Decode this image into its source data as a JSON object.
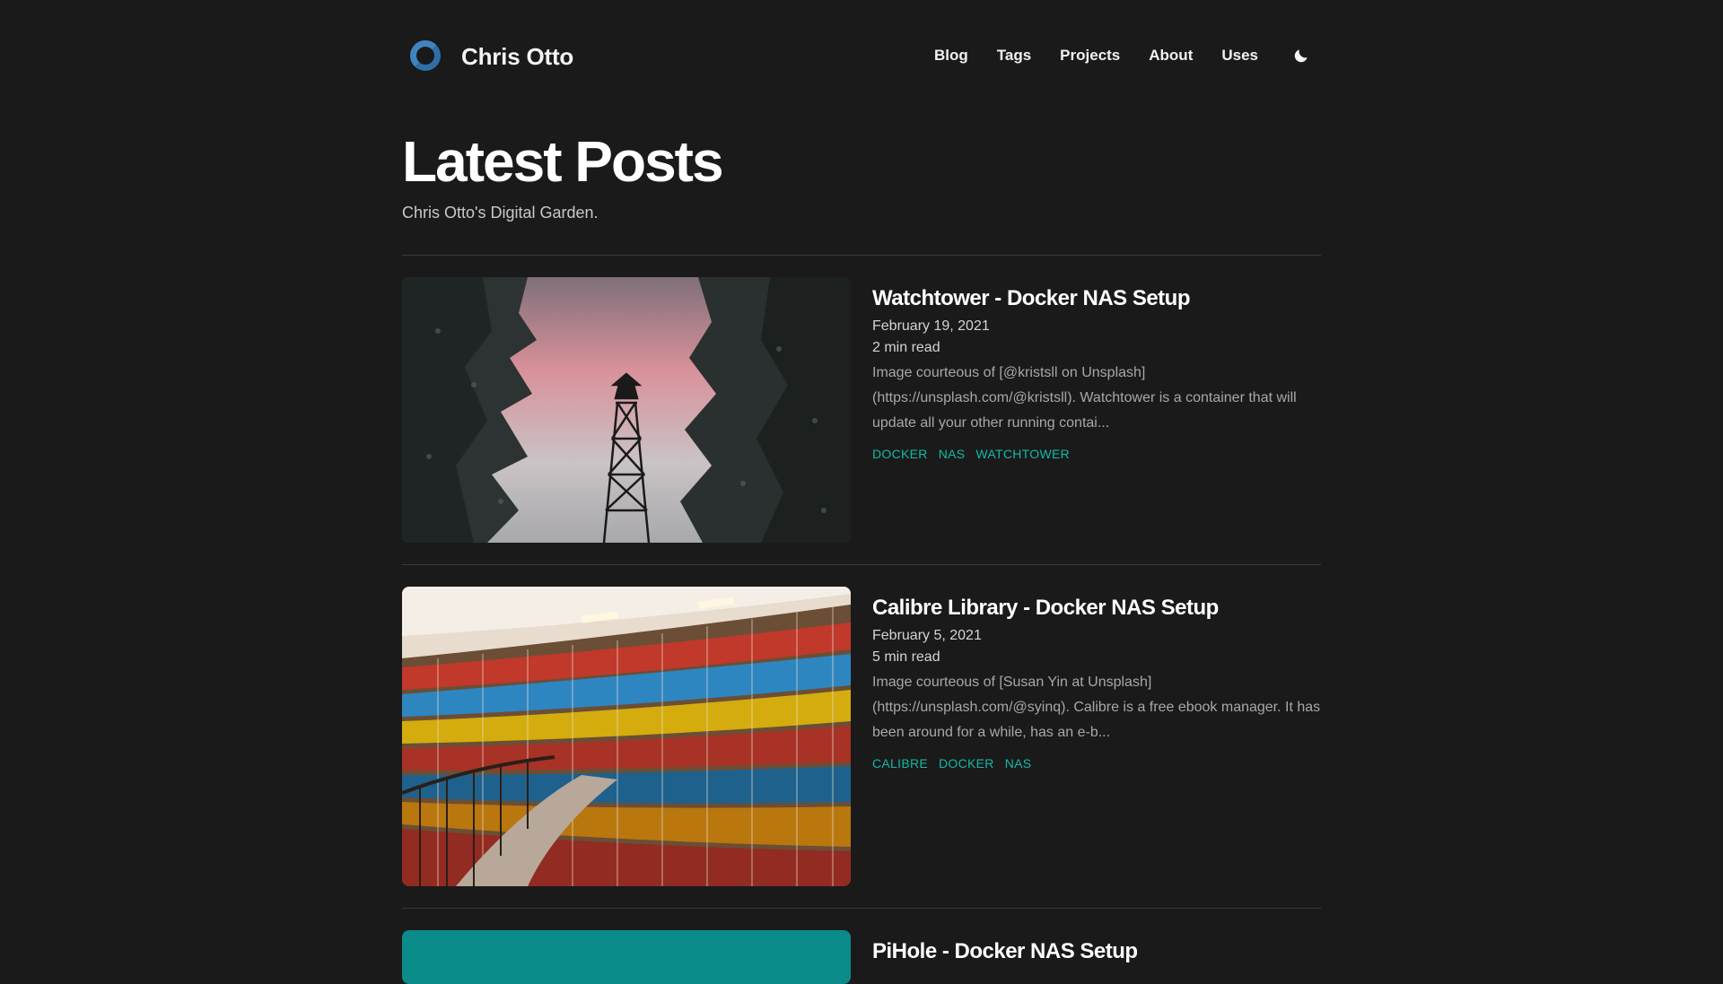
{
  "site": {
    "name": "Chris Otto",
    "logo_icon": "ring-logo-icon",
    "accent": "#14b8a6"
  },
  "nav": {
    "items": [
      {
        "label": "Blog"
      },
      {
        "label": "Tags"
      },
      {
        "label": "Projects"
      },
      {
        "label": "About"
      },
      {
        "label": "Uses"
      }
    ],
    "theme_toggle_icon": "moon-icon"
  },
  "page": {
    "title": "Latest Posts",
    "subtitle": "Chris Otto's Digital Garden."
  },
  "posts": [
    {
      "title": "Watchtower - Docker NAS Setup",
      "date": "February 19, 2021",
      "read_time": "2 min read",
      "excerpt": "Image courteous of [@kristsll on Unsplash](https://unsplash.com/@kristsll). Watchtower is a container that will update all your other running contai...",
      "tags": [
        "DOCKER",
        "NAS",
        "WATCHTOWER"
      ],
      "image": "forest-watchtower-image"
    },
    {
      "title": "Calibre Library - Docker NAS Setup",
      "date": "February 5, 2021",
      "read_time": "5 min read",
      "excerpt": "Image courteous of [Susan Yin at Unsplash](https://unsplash.com/@syinq). Calibre is a free ebook manager. It has been around for a while, has an e-b...",
      "tags": [
        "CALIBRE",
        "DOCKER",
        "NAS"
      ],
      "image": "library-bookshelves-image"
    },
    {
      "title": "PiHole - Docker NAS Setup",
      "image": "teal-placeholder-image"
    }
  ]
}
